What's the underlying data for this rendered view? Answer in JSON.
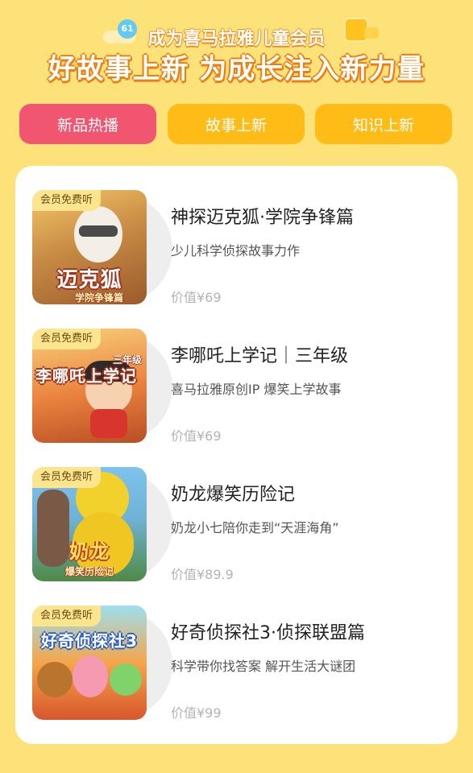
{
  "banner": {
    "subtitle": "成为喜马拉雅儿童会员",
    "title": "好故事上新 为成长注入新力量",
    "bubble_number": "61"
  },
  "tabs": [
    {
      "label": "新品热播",
      "active": true
    },
    {
      "label": "故事上新",
      "active": false
    },
    {
      "label": "知识上新",
      "active": false
    }
  ],
  "colors": {
    "background": "#fde27a",
    "tab_active": "#f25570",
    "tab_inactive": "#ffbc17",
    "badge": "#fde58f"
  },
  "items": [
    {
      "badge": "会员免费听",
      "cover_text": "迈克狐",
      "cover_sub": "学院争锋篇",
      "title": "神探迈克狐·学院争锋篇",
      "desc": "少儿科学侦探故事力作",
      "price": "价值¥69"
    },
    {
      "badge": "会员免费听",
      "cover_text": "李哪吒上学记",
      "cover_sub": "三年级",
      "title": "李哪吒上学记｜三年级",
      "desc": "喜马拉雅原创IP 爆笑上学故事",
      "price": "价值¥69"
    },
    {
      "badge": "会员免费听",
      "cover_text": "奶龙",
      "cover_sub": "爆笑历险记",
      "title": "奶龙爆笑历险记",
      "desc": "奶龙小七陪你走到“天涯海角”",
      "price": "价值¥89.9"
    },
    {
      "badge": "会员免费听",
      "cover_text": "好奇侦探社3",
      "cover_sub": "",
      "title": "好奇侦探社3·侦探联盟篇",
      "desc": "科学带你找答案 解开生活大谜团",
      "price": "价值¥99"
    }
  ]
}
